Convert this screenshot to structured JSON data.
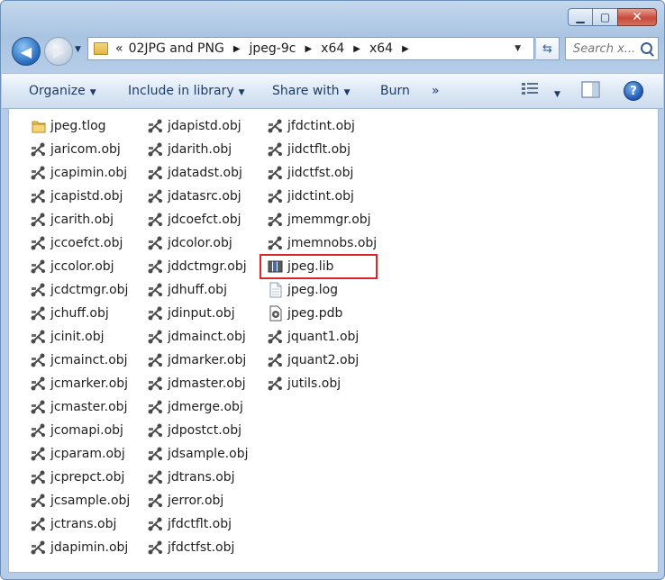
{
  "address": {
    "overflow": "«",
    "crumbs": [
      "02JPG and PNG",
      "jpeg-9c",
      "x64",
      "x64"
    ]
  },
  "search": {
    "placeholder": "Search x..."
  },
  "toolbar": {
    "organize": "Organize",
    "include": "Include in library",
    "share": "Share with",
    "burn": "Burn",
    "more": "»"
  },
  "columns": [
    [
      {
        "name": "jpeg.tlog",
        "type": "folder"
      },
      {
        "name": "jaricom.obj",
        "type": "obj"
      },
      {
        "name": "jcapimin.obj",
        "type": "obj"
      },
      {
        "name": "jcapistd.obj",
        "type": "obj"
      },
      {
        "name": "jcarith.obj",
        "type": "obj"
      },
      {
        "name": "jccoefct.obj",
        "type": "obj"
      },
      {
        "name": "jccolor.obj",
        "type": "obj"
      },
      {
        "name": "jcdctmgr.obj",
        "type": "obj"
      },
      {
        "name": "jchuff.obj",
        "type": "obj"
      },
      {
        "name": "jcinit.obj",
        "type": "obj"
      },
      {
        "name": "jcmainct.obj",
        "type": "obj"
      },
      {
        "name": "jcmarker.obj",
        "type": "obj"
      },
      {
        "name": "jcmaster.obj",
        "type": "obj"
      },
      {
        "name": "jcomapi.obj",
        "type": "obj"
      },
      {
        "name": "jcparam.obj",
        "type": "obj"
      },
      {
        "name": "jcprepct.obj",
        "type": "obj"
      },
      {
        "name": "jcsample.obj",
        "type": "obj"
      },
      {
        "name": "jctrans.obj",
        "type": "obj"
      },
      {
        "name": "jdapimin.obj",
        "type": "obj"
      }
    ],
    [
      {
        "name": "jdapistd.obj",
        "type": "obj"
      },
      {
        "name": "jdarith.obj",
        "type": "obj"
      },
      {
        "name": "jdatadst.obj",
        "type": "obj"
      },
      {
        "name": "jdatasrc.obj",
        "type": "obj"
      },
      {
        "name": "jdcoefct.obj",
        "type": "obj"
      },
      {
        "name": "jdcolor.obj",
        "type": "obj"
      },
      {
        "name": "jddctmgr.obj",
        "type": "obj"
      },
      {
        "name": "jdhuff.obj",
        "type": "obj"
      },
      {
        "name": "jdinput.obj",
        "type": "obj"
      },
      {
        "name": "jdmainct.obj",
        "type": "obj"
      },
      {
        "name": "jdmarker.obj",
        "type": "obj"
      },
      {
        "name": "jdmaster.obj",
        "type": "obj"
      },
      {
        "name": "jdmerge.obj",
        "type": "obj"
      },
      {
        "name": "jdpostct.obj",
        "type": "obj"
      },
      {
        "name": "jdsample.obj",
        "type": "obj"
      },
      {
        "name": "jdtrans.obj",
        "type": "obj"
      },
      {
        "name": "jerror.obj",
        "type": "obj"
      },
      {
        "name": "jfdctflt.obj",
        "type": "obj"
      },
      {
        "name": "jfdctfst.obj",
        "type": "obj"
      }
    ],
    [
      {
        "name": "jfdctint.obj",
        "type": "obj"
      },
      {
        "name": "jidctflt.obj",
        "type": "obj"
      },
      {
        "name": "jidctfst.obj",
        "type": "obj"
      },
      {
        "name": "jidctint.obj",
        "type": "obj"
      },
      {
        "name": "jmemmgr.obj",
        "type": "obj"
      },
      {
        "name": "jmemnobs.obj",
        "type": "obj"
      },
      {
        "name": "jpeg.lib",
        "type": "lib",
        "highlighted": true
      },
      {
        "name": "jpeg.log",
        "type": "log"
      },
      {
        "name": "jpeg.pdb",
        "type": "pdb"
      },
      {
        "name": "jquant1.obj",
        "type": "obj"
      },
      {
        "name": "jquant2.obj",
        "type": "obj"
      },
      {
        "name": "jutils.obj",
        "type": "obj"
      }
    ]
  ],
  "colors": {
    "highlight": "#d62828",
    "toolbar_text": "#1e3c66"
  }
}
